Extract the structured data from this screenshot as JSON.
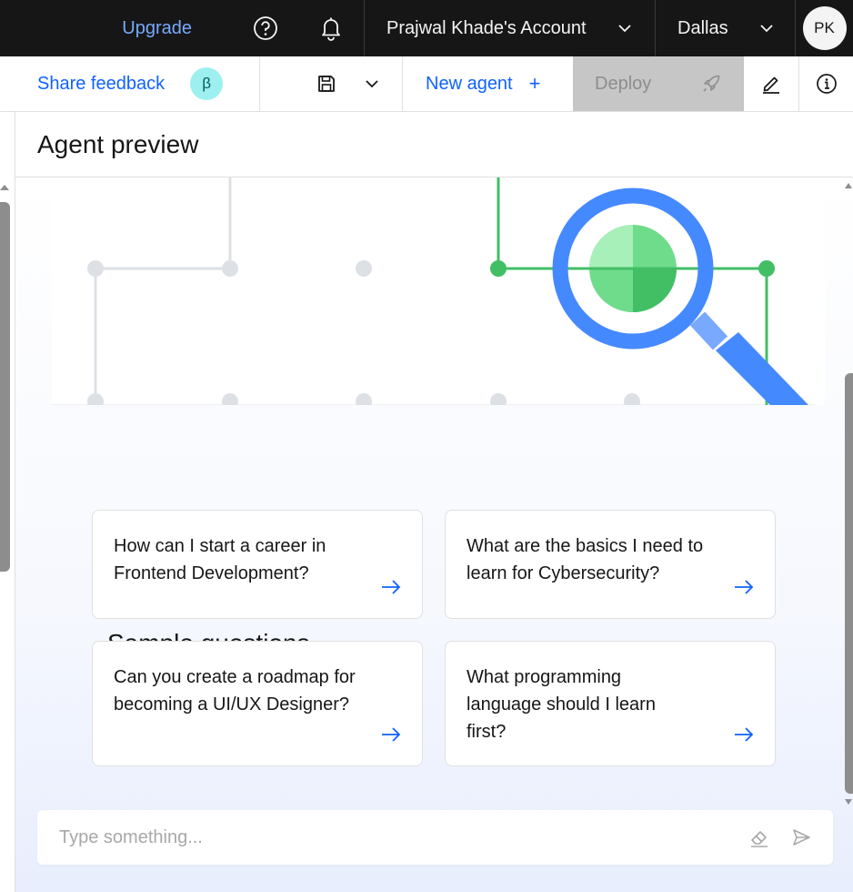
{
  "topbar": {
    "upgrade_label": "Upgrade",
    "help_icon": "help-icon",
    "notification_icon": "bell-icon",
    "account_label": "Prajwal Khade's Account",
    "region_label": "Dallas",
    "avatar_initials": "PK"
  },
  "toolbar": {
    "feedback_label": "Share feedback",
    "beta_badge": "β",
    "save_icon": "save-icon",
    "new_agent_label": "New agent",
    "new_agent_icon": "+",
    "deploy_label": "Deploy",
    "deploy_icon": "rocket-icon",
    "edit_icon": "pencil-icon",
    "info_icon": "info-icon"
  },
  "preview": {
    "title": "Agent preview",
    "sample_questions_title": "Sample questions",
    "questions": [
      "How can I start a career in Frontend Development?",
      "What are the basics I need to learn for Cybersecurity?",
      "Can you create a roadmap for becoming a UI/UX Designer?",
      "What programming language should I learn first?"
    ],
    "composer_placeholder": "Type something..."
  },
  "colors": {
    "topbar_bg": "#161616",
    "link_blue": "#0f62fe",
    "upgrade_blue": "#78a9ff",
    "deploy_disabled_bg": "#c6c6c6",
    "magnifier_blue": "#4589ff",
    "network_green": "#42be65"
  }
}
